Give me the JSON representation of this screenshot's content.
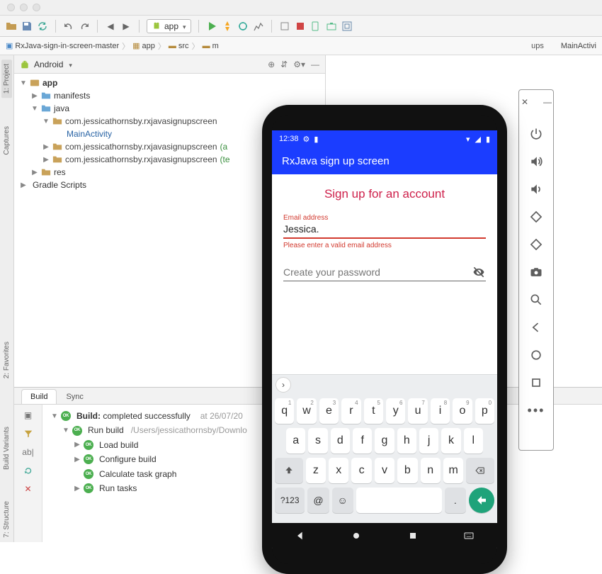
{
  "toolbar": {
    "run_config_label": "app"
  },
  "breadcrumb": {
    "root": "RxJava-sign-in-screen-master",
    "app": "app",
    "src": "src",
    "m_partial": "m",
    "right_cut": "ups",
    "editor_tab": "MainActivi"
  },
  "project": {
    "header": "Android",
    "app": "app",
    "manifests": "manifests",
    "java": "java",
    "pkg": "com.jessicathornsby.rxjavasignupscreen",
    "main_activity": "MainActivity",
    "pkg_a": "com.jessicathornsby.rxjavasignupscreen",
    "pkg_a_hint": "(a",
    "pkg_t": "com.jessicathornsby.rxjavasignupscreen",
    "pkg_t_hint": "(te",
    "res": "res",
    "gradle": "Gradle Scripts"
  },
  "build": {
    "tab_build": "Build",
    "tab_sync": "Sync",
    "root_label": "Build:",
    "root_status": "completed successfully",
    "root_time": "at 26/07/20",
    "run_build": "Run build",
    "run_build_path": "/Users/jessicathornsby/Downlo",
    "load_build": "Load build",
    "configure_build": "Configure build",
    "calc_task": "Calculate task graph",
    "run_tasks": "Run tasks"
  },
  "side": {
    "project": "1: Project",
    "captures": "Captures",
    "favorites": "2: Favorites",
    "build_variants": "Build Variants",
    "structure": "7:  Structure"
  },
  "phone": {
    "time": "12:38",
    "app_title": "RxJava sign up screen",
    "headline": "Sign up for an account",
    "email_label": "Email address",
    "email_value": "Jessica.",
    "email_error": "Please enter a valid email address",
    "password_placeholder": "Create your password",
    "kbd": {
      "row1": [
        "q",
        "w",
        "e",
        "r",
        "t",
        "y",
        "u",
        "i",
        "o",
        "p"
      ],
      "row1_sup": [
        "1",
        "2",
        "3",
        "4",
        "5",
        "6",
        "7",
        "8",
        "9",
        "0"
      ],
      "row2": [
        "a",
        "s",
        "d",
        "f",
        "g",
        "h",
        "j",
        "k",
        "l"
      ],
      "row3": [
        "z",
        "x",
        "c",
        "v",
        "b",
        "n",
        "m"
      ],
      "sym": "?123",
      "at": "@",
      "dot": "."
    }
  }
}
